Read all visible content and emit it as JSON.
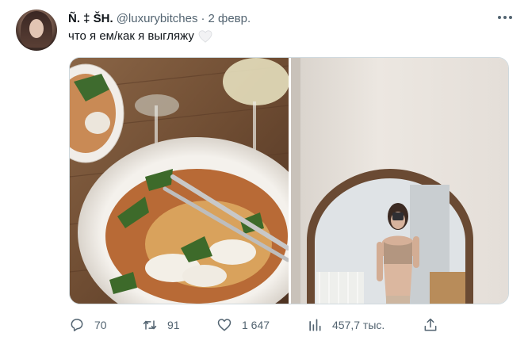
{
  "author": {
    "display_name": "Ñ. ‡ ŠH.",
    "handle": "@luxurybitches",
    "separator": "·",
    "date": "2 февр."
  },
  "tweet": {
    "text": "что я ем/как я выгляжу",
    "emoji": "white-heart"
  },
  "media": {
    "left_image": "plate-of-food-with-wine",
    "right_image": "mirror-selfie"
  },
  "actions": {
    "replies": "70",
    "retweets": "91",
    "likes": "1 647",
    "views": "457,7 тыс."
  },
  "icons": {
    "more": "more-horizontal-icon",
    "reply": "reply-icon",
    "retweet": "retweet-icon",
    "like": "heart-icon",
    "views": "views-chart-icon",
    "share": "share-icon"
  },
  "colors": {
    "text_primary": "#0f1419",
    "text_secondary": "#536471",
    "border": "#cfd9de"
  }
}
